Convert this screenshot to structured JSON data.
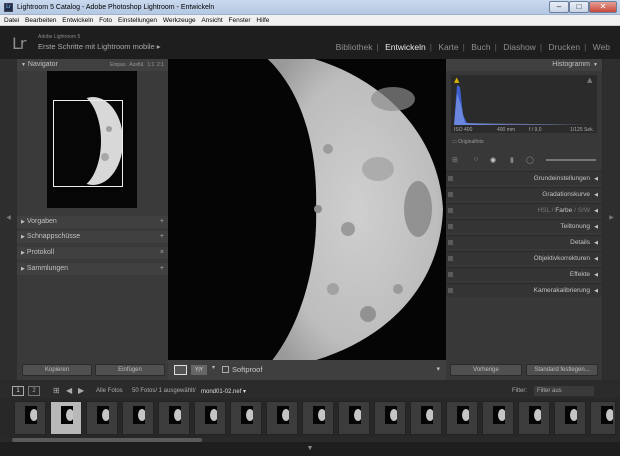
{
  "window": {
    "title": "Lightroom 5 Catalog - Adobe Photoshop Lightroom - Entwickeln"
  },
  "menu": [
    "Datei",
    "Bearbeiten",
    "Entwickeln",
    "Foto",
    "Einstellungen",
    "Werkzeuge",
    "Ansicht",
    "Fenster",
    "Hilfe"
  ],
  "identity": {
    "logo": "Lr",
    "product": "Adobe Lightroom 5",
    "catalog": "Erste Schritte mit Lightroom mobile ▸"
  },
  "modules": [
    "Bibliothek",
    "Entwickeln",
    "Karte",
    "Buch",
    "Diashow",
    "Drucken",
    "Web"
  ],
  "active_module": "Entwickeln",
  "navigator": {
    "title": "Navigator",
    "zoom_options": [
      "Einpas.",
      "Ausfül.",
      "1:1",
      "2:1"
    ]
  },
  "left_sections": [
    "Vorgaben",
    "Schnappschüsse",
    "Protokoll",
    "Sammlungen"
  ],
  "left_buttons": {
    "copy": "Kopieren",
    "paste": "Einfügen"
  },
  "toolbar": {
    "view_label": "Y|Y",
    "softproof": "Softproof"
  },
  "histogram": {
    "title": "Histogramm",
    "iso": "ISO 400",
    "focal": "400 mm",
    "aperture": "f / 9,0",
    "shutter": "1/125 Sek.",
    "original": "Originalfoto"
  },
  "right_sections": [
    "Grundeinstellungen",
    "Gradationskurve",
    "Teiltonung",
    "Details",
    "Objektivkorrekturen",
    "Effekte",
    "Kamerakalibrierung"
  ],
  "hsl": {
    "hsl": "HSL",
    "farbe": "Farbe",
    "sw": "S/W"
  },
  "right_buttons": {
    "previous": "Vorherige",
    "reset": "Standard festlegen..."
  },
  "filmstrip": {
    "pages": [
      "1",
      "2"
    ],
    "source": "Alle Fotos",
    "count": "50 Fotos/ 1 ausgewählt/",
    "file": "mond01-02.nef ▾",
    "filter_label": "Filter:",
    "filter_value": "Filter aus"
  }
}
